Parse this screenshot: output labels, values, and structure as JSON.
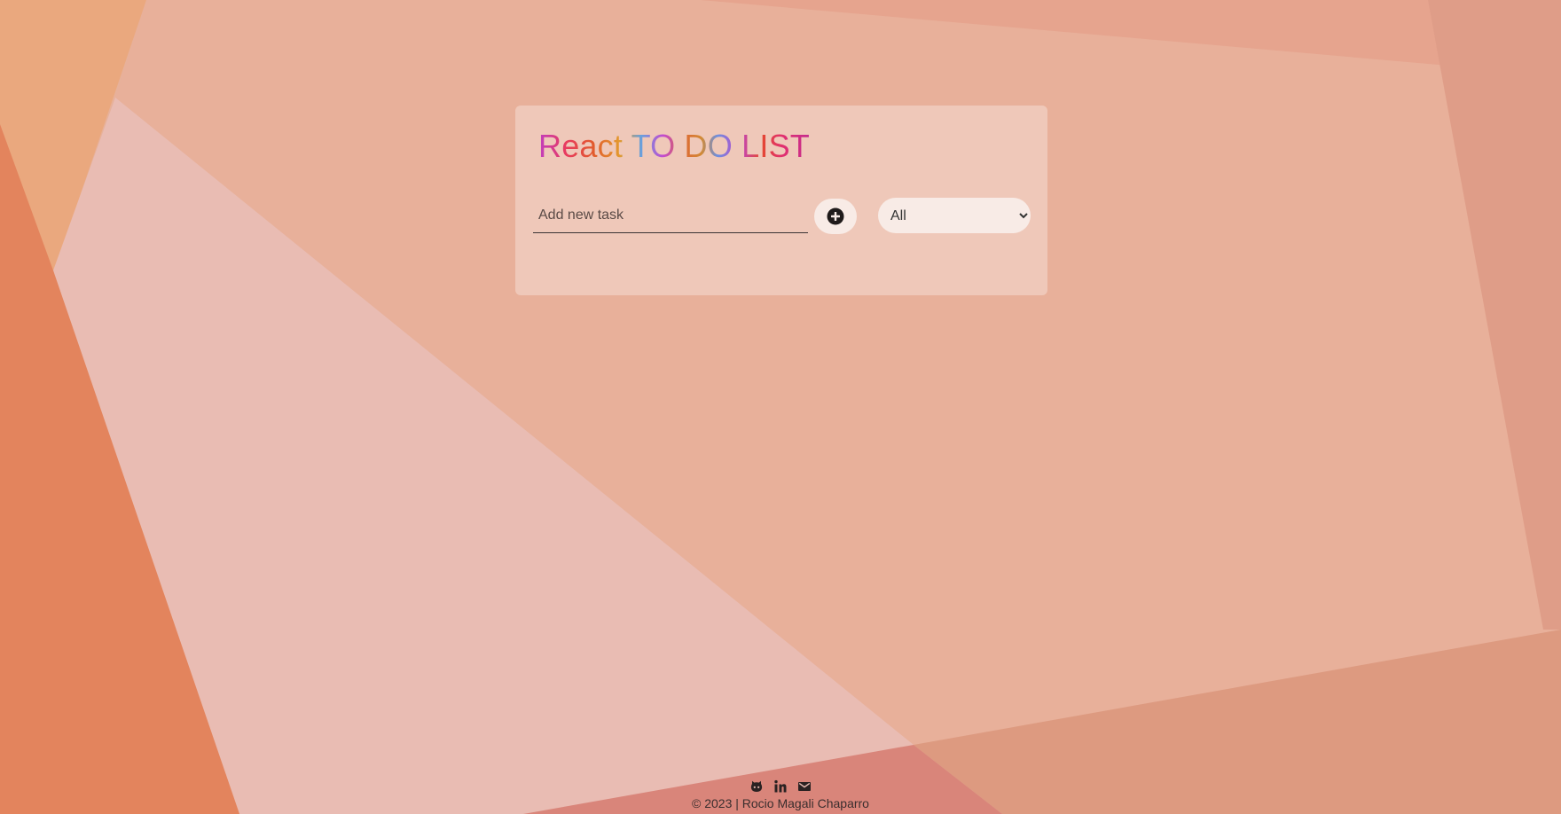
{
  "app": {
    "title": "React TO DO LIST"
  },
  "task_form": {
    "input_placeholder": "Add new task",
    "input_value": "",
    "add_button_icon": "plus-circle-icon"
  },
  "filter": {
    "selected": "All",
    "options": [
      "All"
    ]
  },
  "footer": {
    "icons": [
      "github-icon",
      "linkedin-icon",
      "email-icon"
    ],
    "copyright": "© 2023 | Rocio Magali Chaparro"
  },
  "colors": {
    "background": "#e7b19a",
    "card": "#f0cdc0",
    "control_bg": "#f8ebe6",
    "text_dark": "#2a2222"
  }
}
